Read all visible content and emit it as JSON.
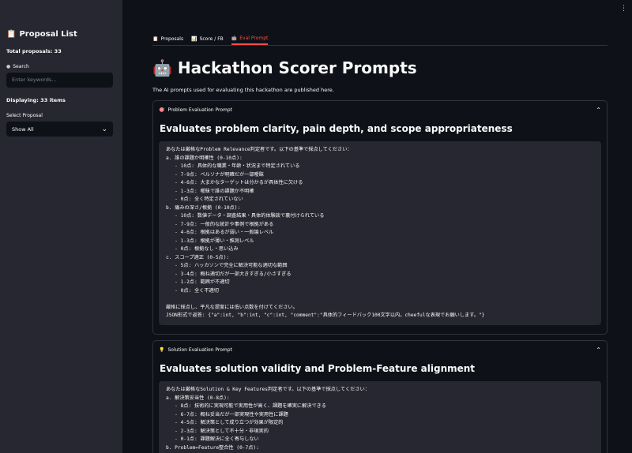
{
  "sidebar": {
    "title_icon": "📋",
    "title": "Proposal List",
    "total": "Total proposals: 33",
    "search_icon": "●",
    "search_label": "Search",
    "search_placeholder": "Enter keywords...",
    "displaying": "Displaying: 33 items",
    "select_label": "Select Proposal",
    "select_value": "Show All",
    "select_arrow": "⌄"
  },
  "menu": {
    "kebab": "⋮"
  },
  "tabs": [
    {
      "icon": "📋",
      "label": "Proposals"
    },
    {
      "icon": "📊",
      "label": "Score / FB"
    },
    {
      "icon": "🤖",
      "label": "Eval Prompt"
    }
  ],
  "main": {
    "title_icon": "🤖",
    "title": "Hackathon Scorer Prompts",
    "subtitle": "The AI prompts used for evaluating this hackathon are published here."
  },
  "expanders": [
    {
      "icon": "🎯",
      "label": "Problem Evaluation Prompt",
      "chevron": "⌃",
      "heading": "Evaluates problem clarity, pain depth, and scope appropriateness",
      "lines": [
        "あなたは厳格なProblem Relevance判定者です。以下の基準で採点してください：",
        "a. 誰の課題か明確性 (0-10点):",
        "   - 10点: 具体的な職業・年齢・状況まで特定されている",
        "   - 7-9点: ペルソナが明確だが一部曖昧",
        "   - 4-6点: 大まかなターゲットは分かるが具体性に欠ける",
        "   - 1-3点: 曖昧で誰の課題か不明確",
        "   - 0点: 全く特定されていない",
        "b. 痛みの深さ/根拠 (0-10点):",
        "   - 10点: 数値データ・調査結果・具体的体験談で裏付けられている",
        "   - 7-9点: 一般的な統計や事例で根拠がある",
        "   - 4-6点: 根拠はあるが弱い・一般論レベル",
        "   - 1-3点: 根拠が薄い・推測レベル",
        "   - 0点: 根拠なし・思い込み",
        "c. スコープ適正 (0-5点):",
        "   - 5点: ハッカソンで完全に解決可能な適切な範囲",
        "   - 3-4点: 概ね適切だが一部大きすぎる/小さすぎる",
        "   - 1-2点: 範囲が不適切",
        "   - 0点: 全く不適切",
        "",
        "厳格に採点し、平凡な提案には低い点数を付けてください。",
        "JSON形式で返答: {\"a\":int, \"b\":int, \"c\":int, \"comment\":\"具体的フィードバック100文字以内。cheefulな表現でお願いします。\"}"
      ]
    },
    {
      "icon": "💡",
      "label": "Solution Evaluation Prompt",
      "chevron": "⌃",
      "heading": "Evaluates solution validity and Problem-Feature alignment",
      "lines": [
        "あなたは厳格なSolution & Key Features判定者です。以下の基準で採点してください：",
        "a. 解決策妥当性 (0-8点):",
        "   - 8点: 技術的に実現可能で実用性が高く、課題を確実に解決できる",
        "   - 6-7点: 概ね妥当だが一部実現性や実用性に課題",
        "   - 4-5点: 解決策として成り立つが効果が限定的",
        "   - 2-3点: 解決策として不十分・非現実的",
        "   - 0-1点: 課題解決に全く寄与しない",
        "b. Problem↔Feature整合性 (0-7点):"
      ]
    }
  ]
}
